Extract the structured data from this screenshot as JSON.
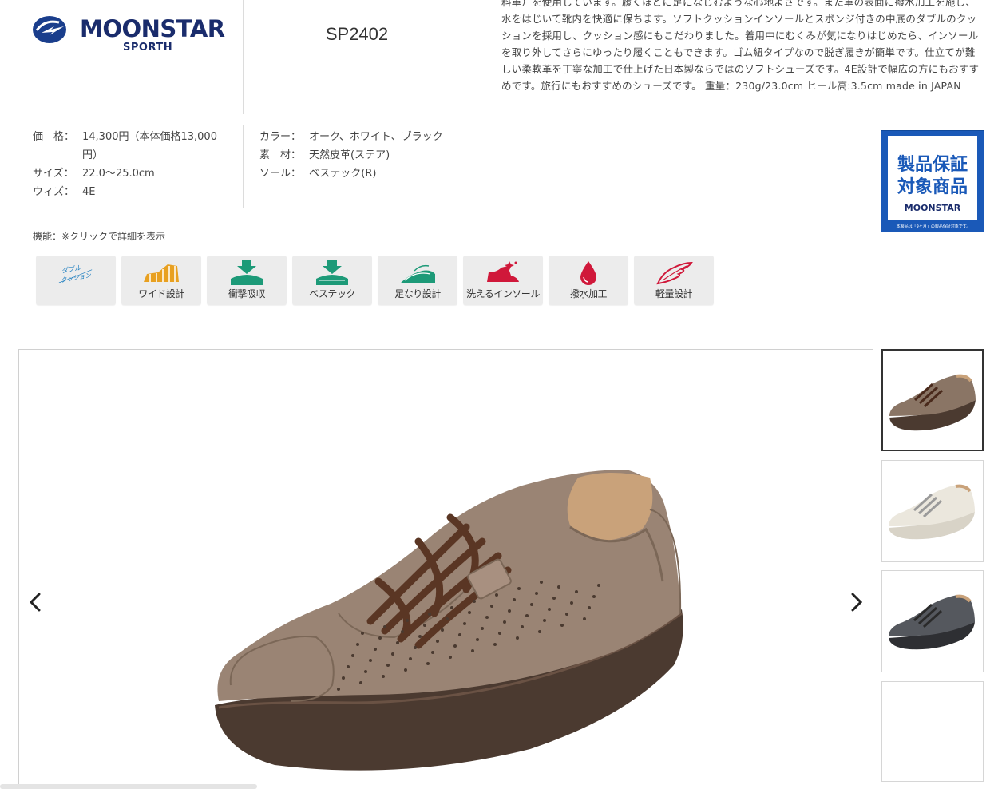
{
  "header": {
    "brand": "MOONSTAR",
    "sub_brand": "SPORTH",
    "model": "SP2402",
    "description": "料革）を使用しています。履くほどに足になじむような心地よさです。また革の表面に撥水加工を施し、水をはじいて靴内を快適に保ちます。ソフトクッションインソールとスポンジ付きの中底のダブルのクッションを採用し、クッション感にもこだわりました。着用中にむくみが気になりはじめたら、インソールを取り外してさらにゆったり履くこともできます。ゴム紐タイプなので脱ぎ履きが簡単です。仕立てが難しい柔軟革を丁寧な加工で仕上げた日本製ならではのソフトシューズです。4E設計で幅広の方にもおすすめです。旅行にもおすすめのシューズです。 重量：230g/23.0cm ヒール高:3.5cm made in JAPAN"
  },
  "specs_left": [
    {
      "label": "価　格：",
      "value": "14,300円（本体価格13,000円）"
    },
    {
      "label": "サイズ：",
      "value": "22.0〜25.0cm"
    },
    {
      "label": "ウィズ：",
      "value": "4E"
    }
  ],
  "specs_right": [
    {
      "label": "カラー：",
      "value": "オーク、ホワイト、ブラック"
    },
    {
      "label": "素　材：",
      "value": "天然皮革(ステア)"
    },
    {
      "label": "ソール：",
      "value": "ベステック(R)"
    }
  ],
  "badge": {
    "line1": "製品保証",
    "line2": "対象商品",
    "brand": "MOONSTAR",
    "fine_print": "本製品は「9ヶ月」の製品保証対象です。"
  },
  "features": {
    "title": "機能：※クリックで詳細を表示",
    "items": [
      {
        "label": "ダブル クッション",
        "icon": "double-cushion-icon",
        "color": "#1f7fc0"
      },
      {
        "label": "ワイド設計",
        "icon": "wide-design-icon",
        "color": "#e8a020"
      },
      {
        "label": "衝撃吸収",
        "icon": "shock-absorb-icon",
        "color": "#1d9a78"
      },
      {
        "label": "ベステック",
        "icon": "bestec-icon",
        "color": "#1d9a78"
      },
      {
        "label": "足なり設計",
        "icon": "foot-shape-icon",
        "color": "#1d9a78"
      },
      {
        "label": "洗えるインソール",
        "icon": "washable-insole-icon",
        "color": "#d0183a"
      },
      {
        "label": "撥水加工",
        "icon": "water-repellent-icon",
        "color": "#d0183a"
      },
      {
        "label": "軽量設計",
        "icon": "lightweight-icon",
        "color": "#d0183a"
      }
    ]
  },
  "gallery": {
    "main_color": "#8a7565",
    "thumbnails": [
      {
        "color": "oak",
        "hex": "#8a7565",
        "active": true
      },
      {
        "color": "white",
        "hex": "#e8e4da",
        "active": false
      },
      {
        "color": "black",
        "hex": "#4a4c50",
        "active": false
      },
      {
        "color": "",
        "hex": "",
        "active": false
      }
    ]
  }
}
